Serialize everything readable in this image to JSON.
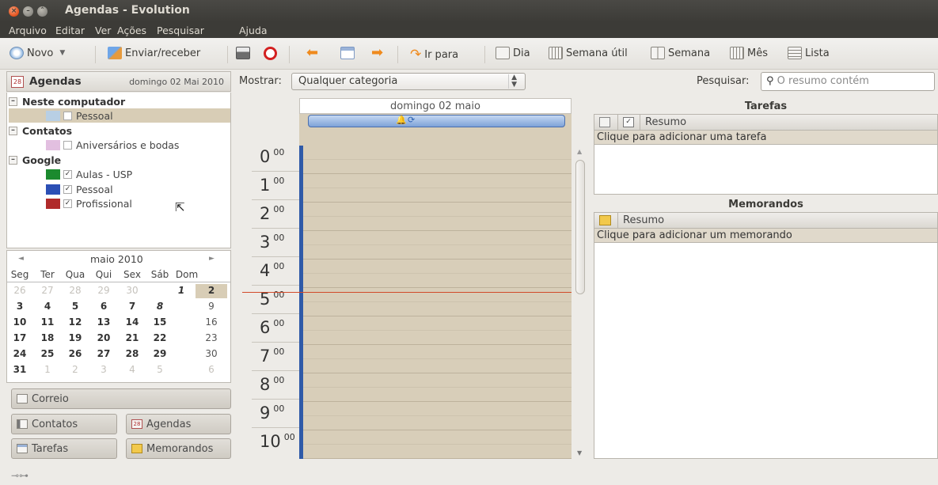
{
  "window": {
    "title": "Agendas - Evolution"
  },
  "menubar": [
    "Arquivo",
    "Editar",
    "Ver",
    "Ações",
    "Pesquisar",
    "Ajuda"
  ],
  "toolbar": {
    "new_label": "Novo",
    "send_receive_label": "Enviar/receber",
    "goto_label": "Ir para",
    "views": [
      "Dia",
      "Semana útil",
      "Semana",
      "Mês",
      "Lista"
    ]
  },
  "sidebar": {
    "title": "Agendas",
    "current_date": "domingo 02 Mai 2010",
    "groups": [
      {
        "name": "Neste computador",
        "sources": [
          {
            "name": "Pessoal",
            "color": "#b8cfe4",
            "checked": false,
            "selected": true
          }
        ]
      },
      {
        "name": "Contatos",
        "sources": [
          {
            "name": "Aniversários e bodas",
            "color": "#e2bfe0",
            "checked": false,
            "selected": false
          }
        ]
      },
      {
        "name": "Google",
        "sources": [
          {
            "name": "Aulas - USP",
            "color": "#1b8a2e",
            "checked": true,
            "selected": false
          },
          {
            "name": "Pessoal",
            "color": "#2b4fb5",
            "checked": true,
            "selected": false
          },
          {
            "name": "Profissional",
            "color": "#b02a2a",
            "checked": true,
            "selected": false
          }
        ]
      }
    ]
  },
  "minical": {
    "prev": "◄",
    "next": "►",
    "month": "maio 2010",
    "weekdays": [
      "Seg",
      "Ter",
      "Qua",
      "Qui",
      "Sex",
      "Sáb",
      "Dom"
    ],
    "weeks": [
      [
        "26",
        "27",
        "28",
        "29",
        "30",
        "1",
        "2"
      ],
      [
        "3",
        "4",
        "5",
        "6",
        "7",
        "8",
        "9"
      ],
      [
        "10",
        "11",
        "12",
        "13",
        "14",
        "15",
        "16"
      ],
      [
        "17",
        "18",
        "19",
        "20",
        "21",
        "22",
        "23"
      ],
      [
        "24",
        "25",
        "26",
        "27",
        "28",
        "29",
        "30"
      ],
      [
        "31",
        "1",
        "2",
        "3",
        "4",
        "5",
        "6"
      ]
    ]
  },
  "switcher": {
    "mail": "Correio",
    "contacts": "Contatos",
    "calendars": "Agendas",
    "tasks": "Tarefas",
    "memos": "Memorandos"
  },
  "filter": {
    "show_label": "Mostrar:",
    "category": "Qualquer categoria",
    "search_label": "Pesquisar:",
    "search_placeholder": "O resumo contém"
  },
  "dayview": {
    "header": "domingo 02 maio",
    "hours": [
      "0",
      "1",
      "2",
      "3",
      "4",
      "5",
      "6",
      "7",
      "8",
      "9",
      "10"
    ],
    "minutes": "00",
    "event_color": "#7ea2d8",
    "now_line_color": "#d24a2a"
  },
  "tasks": {
    "title": "Tarefas",
    "column": "Resumo",
    "add_hint": "Clique para adicionar uma tarefa"
  },
  "memos": {
    "title": "Memorandos",
    "column": "Resumo",
    "add_hint": "Clique para adicionar um memorando"
  }
}
